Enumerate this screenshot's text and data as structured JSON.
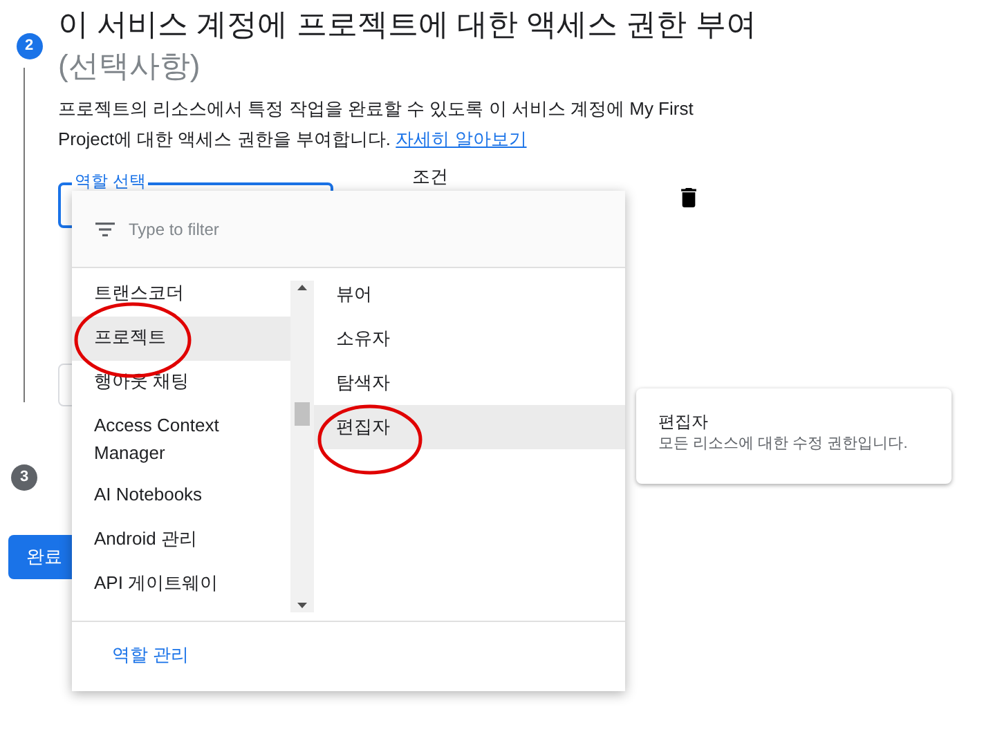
{
  "step2": {
    "number": "2",
    "title": "이 서비스 계정에 프로젝트에 대한 액세스 권한 부여",
    "optional": "(선택사항)",
    "description": "프로젝트의 리소스에서 특정 작업을 완료할 수 있도록 이 서비스 계정에 My First Project에 대한 액세스 권한을 부여합니다.",
    "learn_more": "자세히 알아보기",
    "role_field": {
      "label": "역할 선택",
      "focused": true
    },
    "condition_label": "조건"
  },
  "step3": {
    "number": "3"
  },
  "done_button": "완료",
  "role_menu": {
    "filter_placeholder": "Type to filter",
    "categories": [
      {
        "label": "트랜스코더",
        "selected": false
      },
      {
        "label": "프로젝트",
        "selected": true
      },
      {
        "label": "행아웃 채팅",
        "selected": false
      },
      {
        "label": "Access Context Manager",
        "selected": false
      },
      {
        "label": "AI Notebooks",
        "selected": false
      },
      {
        "label": "Android 관리",
        "selected": false
      },
      {
        "label": "API 게이트웨이",
        "selected": false
      }
    ],
    "roles": [
      {
        "label": "뷰어",
        "selected": false
      },
      {
        "label": "소유자",
        "selected": false
      },
      {
        "label": "탐색자",
        "selected": false
      },
      {
        "label": "편집자",
        "selected": true
      }
    ],
    "manage_roles": "역할 관리"
  },
  "tooltip": {
    "title": "편집자",
    "description": "모든 리소스에 대한 수정 권한입니다."
  }
}
